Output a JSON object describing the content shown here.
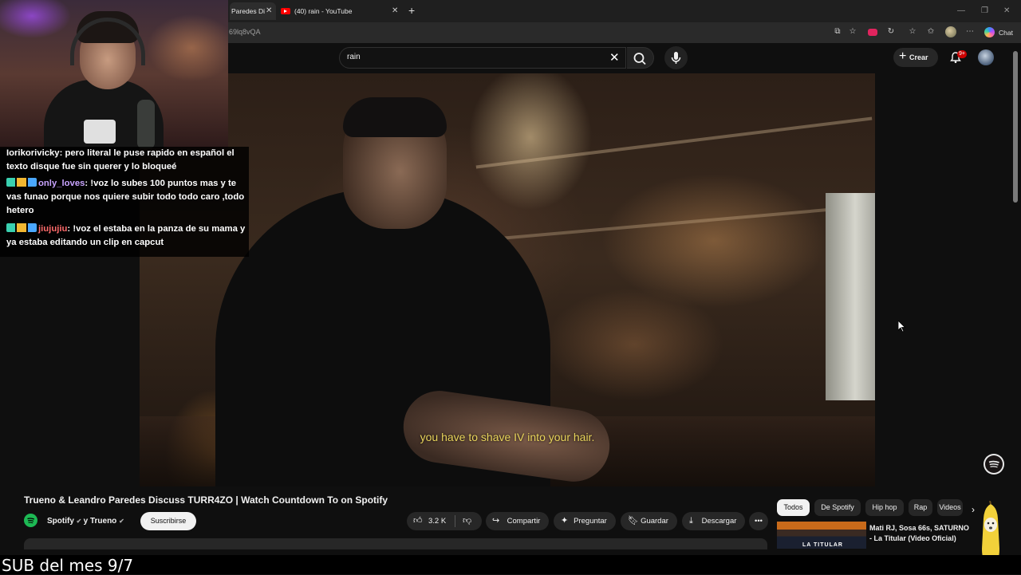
{
  "browser": {
    "tabs": [
      {
        "label": "Paredes Di"
      },
      {
        "label": "(40) rain - YouTube"
      }
    ],
    "new_tab": "+",
    "url": "69lq8vQA",
    "chat_button": "Chat",
    "window_buttons": [
      "—",
      "❐",
      "✕"
    ]
  },
  "youtube": {
    "search_value": "rain",
    "create_label": "Crear",
    "notification_count": "9+"
  },
  "video": {
    "subtitle": "you have to shave IV into your hair.",
    "title": "Trueno & Leandro Paredes Discuss TURR4ZO | Watch Countdown To on Spotify",
    "channel": "Spotify",
    "channel_collab": "y Trueno",
    "subscribe_label": "Suscribirse",
    "likes": "3.2 K",
    "actions": {
      "share": "Compartir",
      "ask": "Preguntar",
      "save": "Guardar",
      "download": "Descargar",
      "more": "•••"
    }
  },
  "chips": [
    "Todos",
    "De Spotify",
    "Hip hop",
    "Rap",
    "Videos"
  ],
  "recommendation": {
    "title": "Mati RJ, Sosa 66s, SATURNO - La Titular (Video Oficial)",
    "thumb_text": "LA TITULAR"
  },
  "stream_chat": [
    {
      "user": "Iorikorivicky",
      "user_color": "#ffffff",
      "text": "pero literal le puse rapido en español el texto disque fue sin querer y lo bloqueé",
      "badges": false
    },
    {
      "user": "only_loves",
      "user_color": "#c9a4ff",
      "text": "!voz lo subes 100 puntos mas y te vas funao porque nos quiere subir todo todo caro ,todo hetero",
      "badges": true
    },
    {
      "user": "jiujujiu",
      "user_color": "#ff6b6b",
      "text": "!voz el estaba en la panza de su mama y ya estaba editando un clip en capcut",
      "badges": true
    }
  ],
  "stream_footer": "SUB del mes 9/7"
}
